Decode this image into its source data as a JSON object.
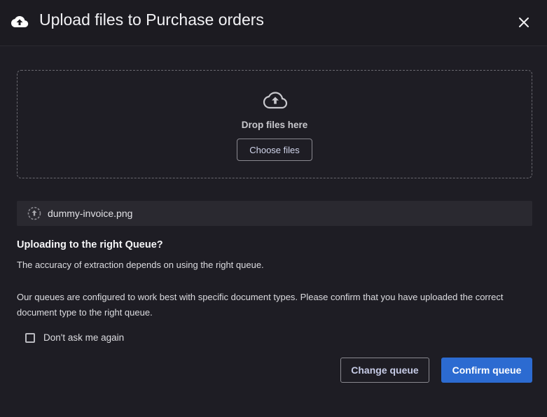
{
  "dialog": {
    "title": "Upload files to Purchase orders",
    "title_icon": "cloud-upload-icon",
    "close_icon": "close-icon"
  },
  "dropzone": {
    "icon": "cloud-upload-outline-icon",
    "text": "Drop files here",
    "choose_label": "Choose files"
  },
  "files": [
    {
      "name": "dummy-invoice.png",
      "status_icon": "upload-progress-icon"
    }
  ],
  "confirm": {
    "title": "Uploading to the right Queue?",
    "paragraph1": "The accuracy of extraction depends on using the right queue.",
    "paragraph2": "Our queues are configured to work best with specific document types. Please confirm that you have uploaded the correct document type to the right queue.",
    "checkbox_label": "Don't ask me again",
    "checkbox_checked": false
  },
  "actions": {
    "change_label": "Change queue",
    "confirm_label": "Confirm queue"
  },
  "colors": {
    "background": "#1e1d24",
    "primary": "#2c6bd1"
  }
}
